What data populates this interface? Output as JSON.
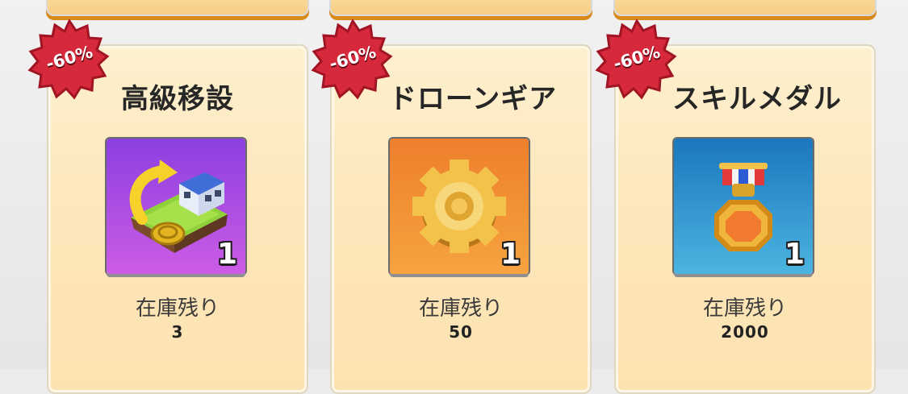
{
  "badge_color": "#d62a3c",
  "items": [
    {
      "name": "高級移設",
      "discount": "-60%",
      "quantity": "1",
      "stock_label": "在庫残り",
      "stock_value": "3",
      "icon": "relocation-icon",
      "icon_bg": [
        "#8c3fe0",
        "#cc5ce6"
      ]
    },
    {
      "name": "ドローンギア",
      "discount": "-60%",
      "quantity": "1",
      "stock_label": "在庫残り",
      "stock_value": "50",
      "icon": "gear-icon",
      "icon_bg": [
        "#ee7f2c",
        "#f6a340"
      ]
    },
    {
      "name": "スキルメダル",
      "discount": "-60%",
      "quantity": "1",
      "stock_label": "在庫残り",
      "stock_value": "2000",
      "icon": "medal-icon",
      "icon_bg": [
        "#1b77bd",
        "#4bb4e0"
      ]
    }
  ]
}
